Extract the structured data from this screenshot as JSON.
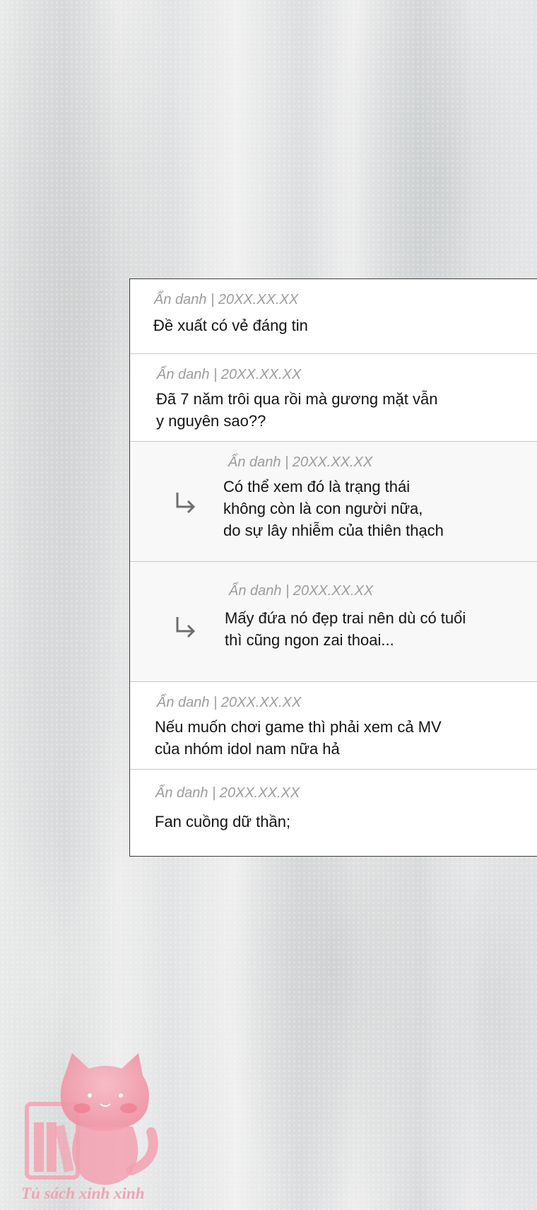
{
  "comments": [
    {
      "meta": "Ẩn danh | 20XX.XX.XX",
      "text": "Đề xuất có vẻ đáng tin"
    },
    {
      "meta": "Ẩn danh | 20XX.XX.XX",
      "text": "Đã 7 năm trôi qua rồi mà gương mặt vẫn\ny nguyên sao??"
    },
    {
      "meta": "Ẩn danh | 20XX.XX.XX",
      "text": "Có thể xem đó là trạng thái\nkhông còn là con người nữa,\ndo sự lây nhiễm của thiên thạch",
      "is_reply": true,
      "icon": "reply-arrow-icon"
    },
    {
      "meta": "Ẩn danh | 20XX.XX.XX",
      "text": "Mấy đứa nó đẹp trai nên dù có tuổi\nthì cũng ngon zai thoai...",
      "is_reply": true,
      "icon": "reply-arrow-icon"
    },
    {
      "meta": "Ẩn danh | 20XX.XX.XX",
      "text": "Nếu muốn chơi game thì phải xem cả MV\ncủa nhóm idol nam nữa hả"
    },
    {
      "meta": "Ẩn danh | 20XX.XX.XX",
      "text": "Fan cuồng dữ thần;"
    }
  ],
  "watermark": {
    "text": "Tủ sách xinh xinh",
    "icon": "pink-cat-bookshelf-logo"
  },
  "colors": {
    "panel_border": "#3d3d3d",
    "meta_text": "#9c9c9c",
    "reply_bg": "#f8f8f8",
    "watermark_pink": "#f1a3b2"
  }
}
